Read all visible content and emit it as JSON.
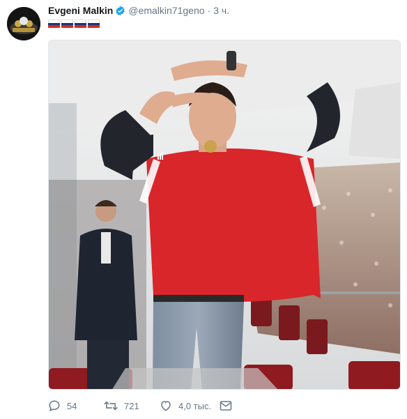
{
  "tweet": {
    "author_name": "Evgeni Malkin",
    "author_handle": "@emalkin71geno",
    "separator": "·",
    "timestamp": "3 ч.",
    "flags": [
      "russian-flag",
      "russian-flag",
      "russian-flag",
      "russian-flag"
    ],
    "verified_icon": "verified-badge-icon"
  },
  "actions": {
    "reply_count": "54",
    "retweet_count": "721",
    "like_count": "4,0 тыс.",
    "reply_icon": "reply-icon",
    "retweet_icon": "retweet-icon",
    "like_icon": "heart-icon",
    "dm_icon": "direct-message-icon"
  },
  "colors": {
    "link_blue": "#1da1f2",
    "secondary_text": "#657786",
    "flag_white": "#ffffff",
    "flag_blue": "#1c3578",
    "flag_red": "#d52b1e",
    "jersey_red": "#d8262b"
  }
}
